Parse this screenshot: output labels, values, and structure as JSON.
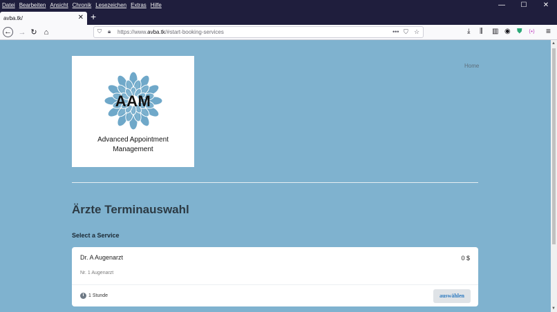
{
  "menu": [
    "Datei",
    "Bearbeiten",
    "Ansicht",
    "Chronik",
    "Lesezeichen",
    "Extras",
    "Hilfe"
  ],
  "window_controls": {
    "minimize": "—",
    "maximize": "☐",
    "close": "✕"
  },
  "tab": {
    "title": "avba.tk/",
    "close": "✕",
    "new_tab": "+"
  },
  "nav": {
    "back": "←",
    "forward": "→",
    "reload": "↻",
    "home": "⌂"
  },
  "url": {
    "prefix": "https://www.",
    "domain": "avba.tk",
    "path": "/#start-booking-services"
  },
  "url_actions": {
    "more": "•••",
    "pocket": "⛉",
    "bookmark": "☆"
  },
  "toolbar": {
    "downloads": "⤓",
    "library": "⫼",
    "sidebar": "▥",
    "account": "◉",
    "shield": "⛊",
    "extension": "⟨•⟩",
    "menu": "≡"
  },
  "logo": {
    "letters": "AAM",
    "line1": "Advanced Appointment",
    "line2": "Management"
  },
  "nav_links": {
    "home": "Home"
  },
  "page_title": "Ärzte Terminauswahl",
  "section_label": "Select a Service",
  "service": {
    "name": "Dr. A Augenarzt",
    "price": "0 $",
    "description": "Nr. 1 Augenarzt",
    "duration": "1 Stunde",
    "select_label": "auswählen"
  },
  "colors": {
    "page_bg": "#7fb2cf",
    "titlebar": "#1f1e3d",
    "logo_petal": "#6fa8c9",
    "link": "#2e7bc0"
  }
}
